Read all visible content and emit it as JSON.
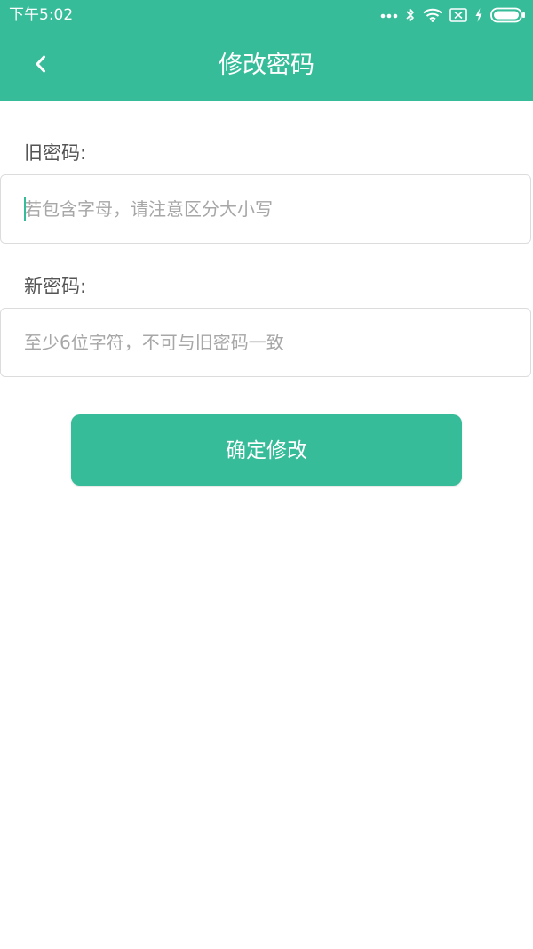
{
  "status_bar": {
    "time": "下午5:02",
    "icons": [
      "more-dots-icon",
      "bluetooth-icon",
      "wifi-icon",
      "no-sim-icon",
      "charging-icon",
      "battery-icon"
    ]
  },
  "nav": {
    "title": "修改密码",
    "back_icon": "chevron-left-icon"
  },
  "form": {
    "old_password": {
      "label": "旧密码:",
      "value": "",
      "placeholder": "若包含字母，请注意区分大小写"
    },
    "new_password": {
      "label": "新密码:",
      "value": "",
      "placeholder": "至少6位字符，不可与旧密码一致"
    },
    "submit_label": "确定修改"
  },
  "colors": {
    "accent": "#36bc98",
    "background": "#ffffff",
    "label_text": "#555555",
    "placeholder_text": "#a7a7a7",
    "input_border": "#dcdcdc"
  }
}
